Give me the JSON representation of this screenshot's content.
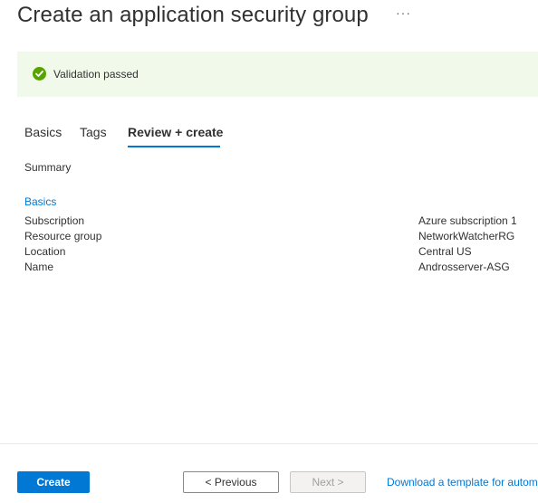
{
  "header": {
    "title": "Create an application security group",
    "more_label": "···"
  },
  "validation": {
    "icon": "check-circle-icon",
    "text": "Validation passed",
    "color": "#57a300",
    "background": "#f1faea"
  },
  "tabs": [
    {
      "label": "Basics",
      "selected": false
    },
    {
      "label": "Tags",
      "selected": false
    },
    {
      "label": "Review + create",
      "selected": true
    }
  ],
  "summary": {
    "heading": "Summary",
    "section": "Basics",
    "rows": [
      {
        "label": "Subscription",
        "value": "Azure subscription 1"
      },
      {
        "label": "Resource group",
        "value": "NetworkWatcherRG"
      },
      {
        "label": "Location",
        "value": "Central US"
      },
      {
        "label": "Name",
        "value": "Androsserver-ASG"
      }
    ]
  },
  "footer": {
    "create_label": "Create",
    "previous_label": "< Previous",
    "next_label": "Next >",
    "download_label": "Download a template for automation"
  },
  "colors": {
    "accent": "#0078d4"
  }
}
